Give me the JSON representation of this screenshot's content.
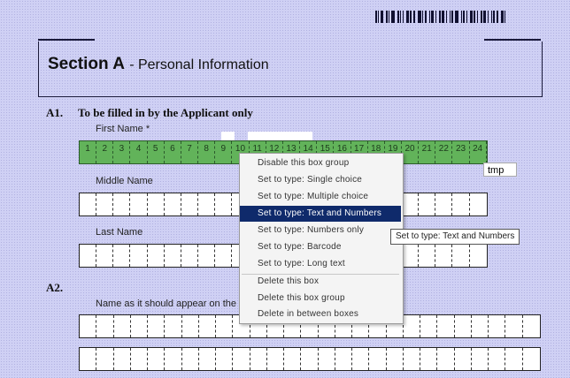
{
  "header": {
    "section_label": "Section A",
    "section_subtitle": "- Personal Information"
  },
  "questions": [
    {
      "number": "A1.",
      "text": "To be filled in by the Applicant only"
    },
    {
      "number": "A2.",
      "text": ""
    }
  ],
  "fields": {
    "first_name_label": "First Name *",
    "middle_name_label": "Middle Name",
    "last_name_label": "Last Name",
    "name_appear_label": "Name as it should appear on the"
  },
  "box_numbers": [
    "1",
    "2",
    "3",
    "4",
    "5",
    "6",
    "7",
    "8",
    "9",
    "10",
    "11",
    "12",
    "13",
    "14",
    "15",
    "16",
    "17",
    "18",
    "19",
    "20",
    "21",
    "22",
    "23",
    "24"
  ],
  "context_menu": {
    "items": [
      {
        "label": "Disable this box group",
        "selected": false
      },
      {
        "label": "Set to type: Single choice",
        "selected": false
      },
      {
        "label": "Set to type: Multiple choice",
        "selected": false
      },
      {
        "label": "Set to type: Text and Numbers",
        "selected": true
      },
      {
        "label": "Set to type: Numbers only",
        "selected": false
      },
      {
        "label": "Set to type: Barcode",
        "selected": false
      },
      {
        "label": "Set to type: Long text",
        "selected": false
      },
      {
        "label": "Delete this box",
        "selected": false
      },
      {
        "label": "Delete this box group",
        "selected": false
      },
      {
        "label": "Delete in between boxes",
        "selected": false
      }
    ]
  },
  "tooltip": "Set to type: Text and Numbers",
  "tmp_value": "tmp",
  "colors": {
    "background": "#cfd0f4",
    "selected_group": "#62b35a",
    "menu_highlight": "#0f2a6b"
  }
}
